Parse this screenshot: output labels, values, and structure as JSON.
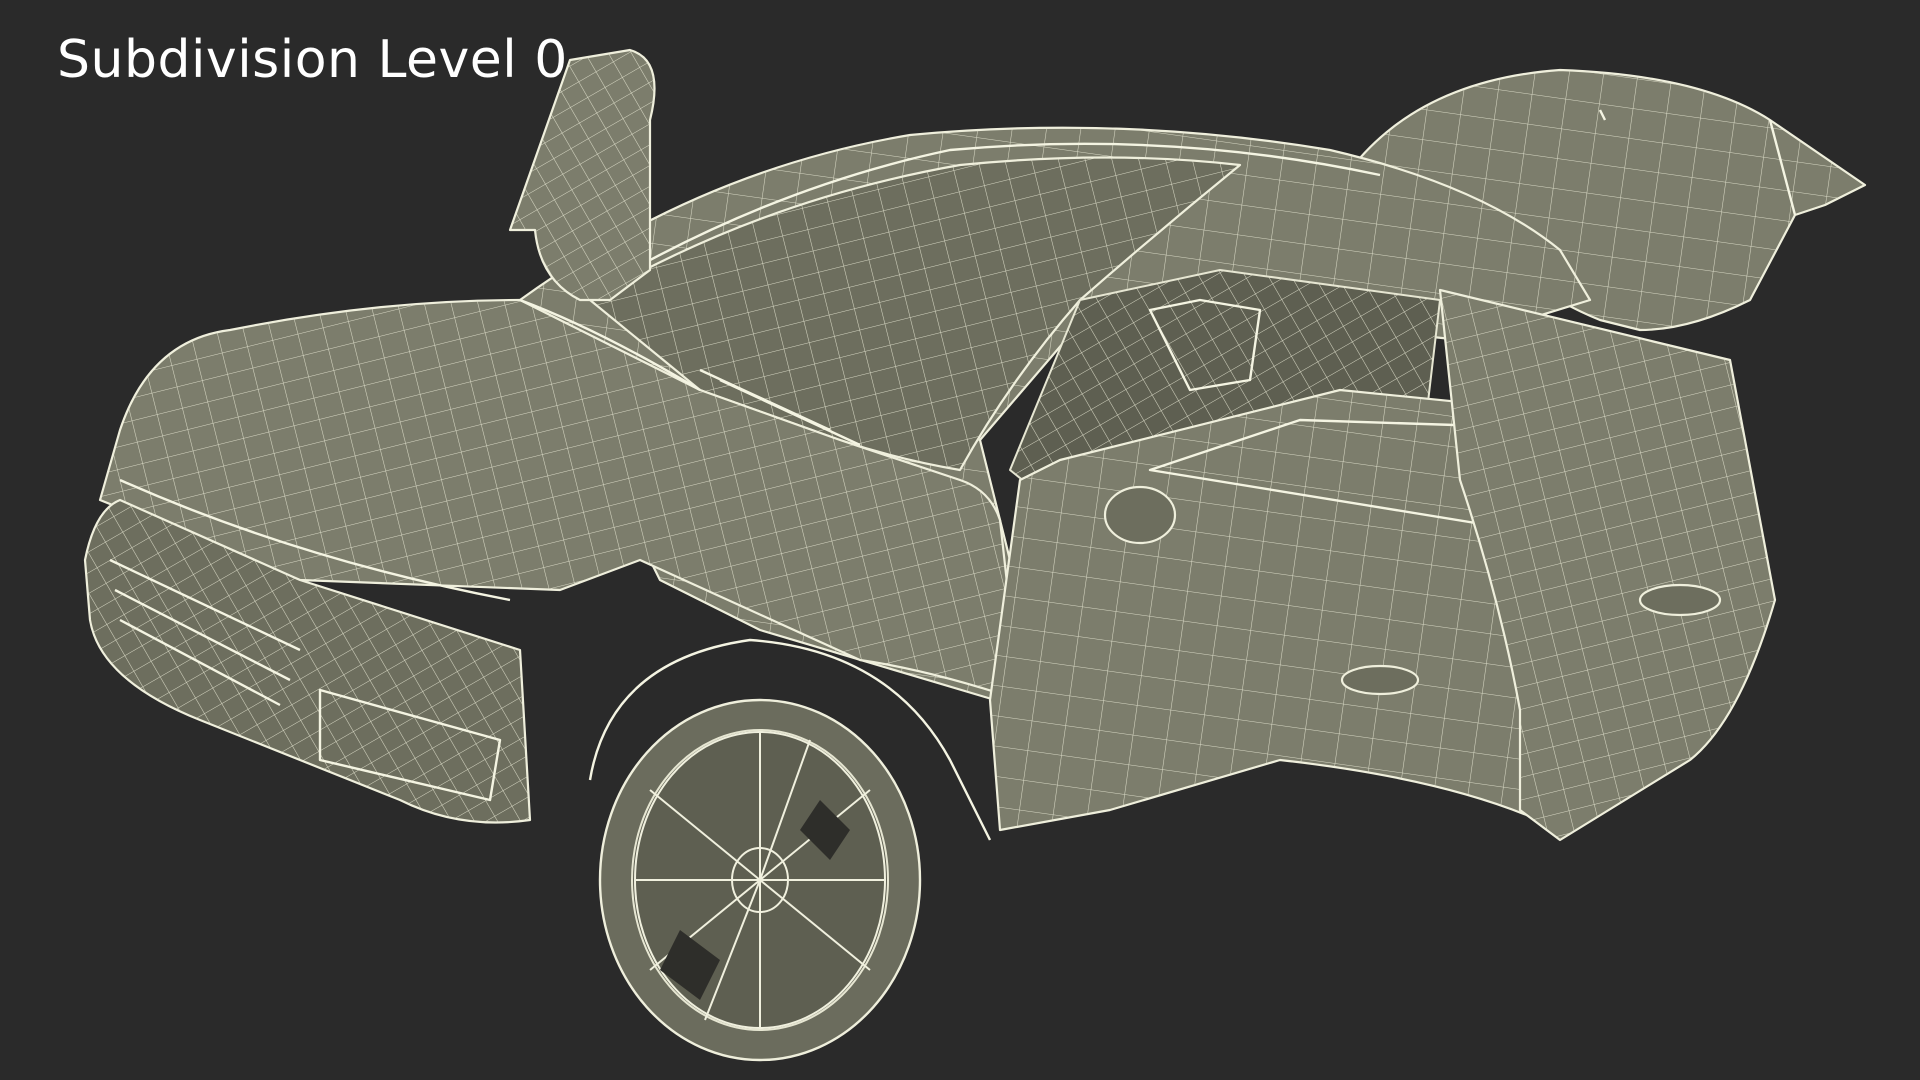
{
  "viewport": {
    "title": "Subdivision Level 0",
    "background_color": "#2a2a2a",
    "model_fill_color": "#7c7d6c",
    "wire_color": "#efefdc"
  }
}
